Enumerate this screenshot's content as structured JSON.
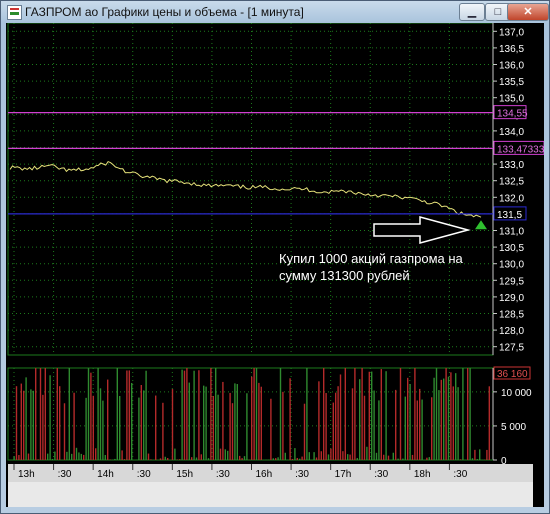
{
  "window": {
    "title": "ГАЗПРОМ ао Графики цены и объема - [1 минута]",
    "controls": {
      "minimize": "▁",
      "maximize": "□",
      "close": "✕"
    }
  },
  "price_panel": {
    "markers": [
      {
        "value": 134.55,
        "label": "134,55",
        "color": "#d040d0"
      },
      {
        "value": 133.47333,
        "label": "133,47333",
        "color": "#d040d0"
      },
      {
        "value": 131.5,
        "label": "131,5",
        "color": "#2a2ad0"
      }
    ],
    "current_price_label": "131,5"
  },
  "volume_panel": {
    "max_label": "36 160"
  },
  "annotation": "Купил 1000 акций газпрома  на\nсумму 131300 рублей",
  "colors": {
    "price_line": "#e6e27a",
    "volume_up": "#2f8a2f",
    "volume_down": "#b42a2a",
    "grid": "#1c7a1c",
    "buy_marker": "#2fbf2f"
  },
  "chart_data": [
    {
      "type": "line",
      "title": "",
      "xlabel": "",
      "ylabel": "",
      "ylim": [
        127.25,
        137.25
      ],
      "y_ticks": [
        "137,0",
        "136,5",
        "136,0",
        "135,5",
        "135,0",
        "134,5",
        "134,0",
        "133,5",
        "133,0",
        "132,5",
        "132,0",
        "131,5",
        "131,0",
        "130,5",
        "130,0",
        "129,5",
        "129,0",
        "128,5",
        "128,0",
        "127,5"
      ],
      "series": [
        {
          "x": [
            "13:00",
            "13:15",
            "13:30",
            "13:45",
            "14:00",
            "14:15",
            "14:30",
            "14:45",
            "15:00",
            "15:15",
            "15:30",
            "15:45",
            "16:00",
            "16:15",
            "16:30",
            "16:45",
            "17:00",
            "17:15",
            "17:30",
            "17:45",
            "18:00",
            "18:15",
            "18:30",
            "18:45",
            "18:50"
          ],
          "values": [
            132.9,
            132.85,
            132.95,
            132.8,
            132.85,
            133.05,
            132.75,
            132.6,
            132.5,
            132.45,
            132.35,
            132.35,
            132.3,
            132.3,
            132.25,
            132.25,
            132.15,
            132.2,
            132.1,
            132.05,
            132.0,
            131.9,
            131.75,
            131.5,
            131.4
          ]
        }
      ],
      "grid": true
    },
    {
      "type": "bar",
      "title": "",
      "xlabel": "",
      "ylabel": "",
      "ylim": [
        0,
        13500
      ],
      "y_ticks": [
        "10 000",
        "5 000",
        "0"
      ],
      "x_ticks": [
        "13h",
        ":30",
        "14h",
        ":30",
        "15h",
        ":30",
        "16h",
        ":30",
        "17h",
        ":30",
        "18h",
        ":30"
      ],
      "grid": true
    }
  ]
}
